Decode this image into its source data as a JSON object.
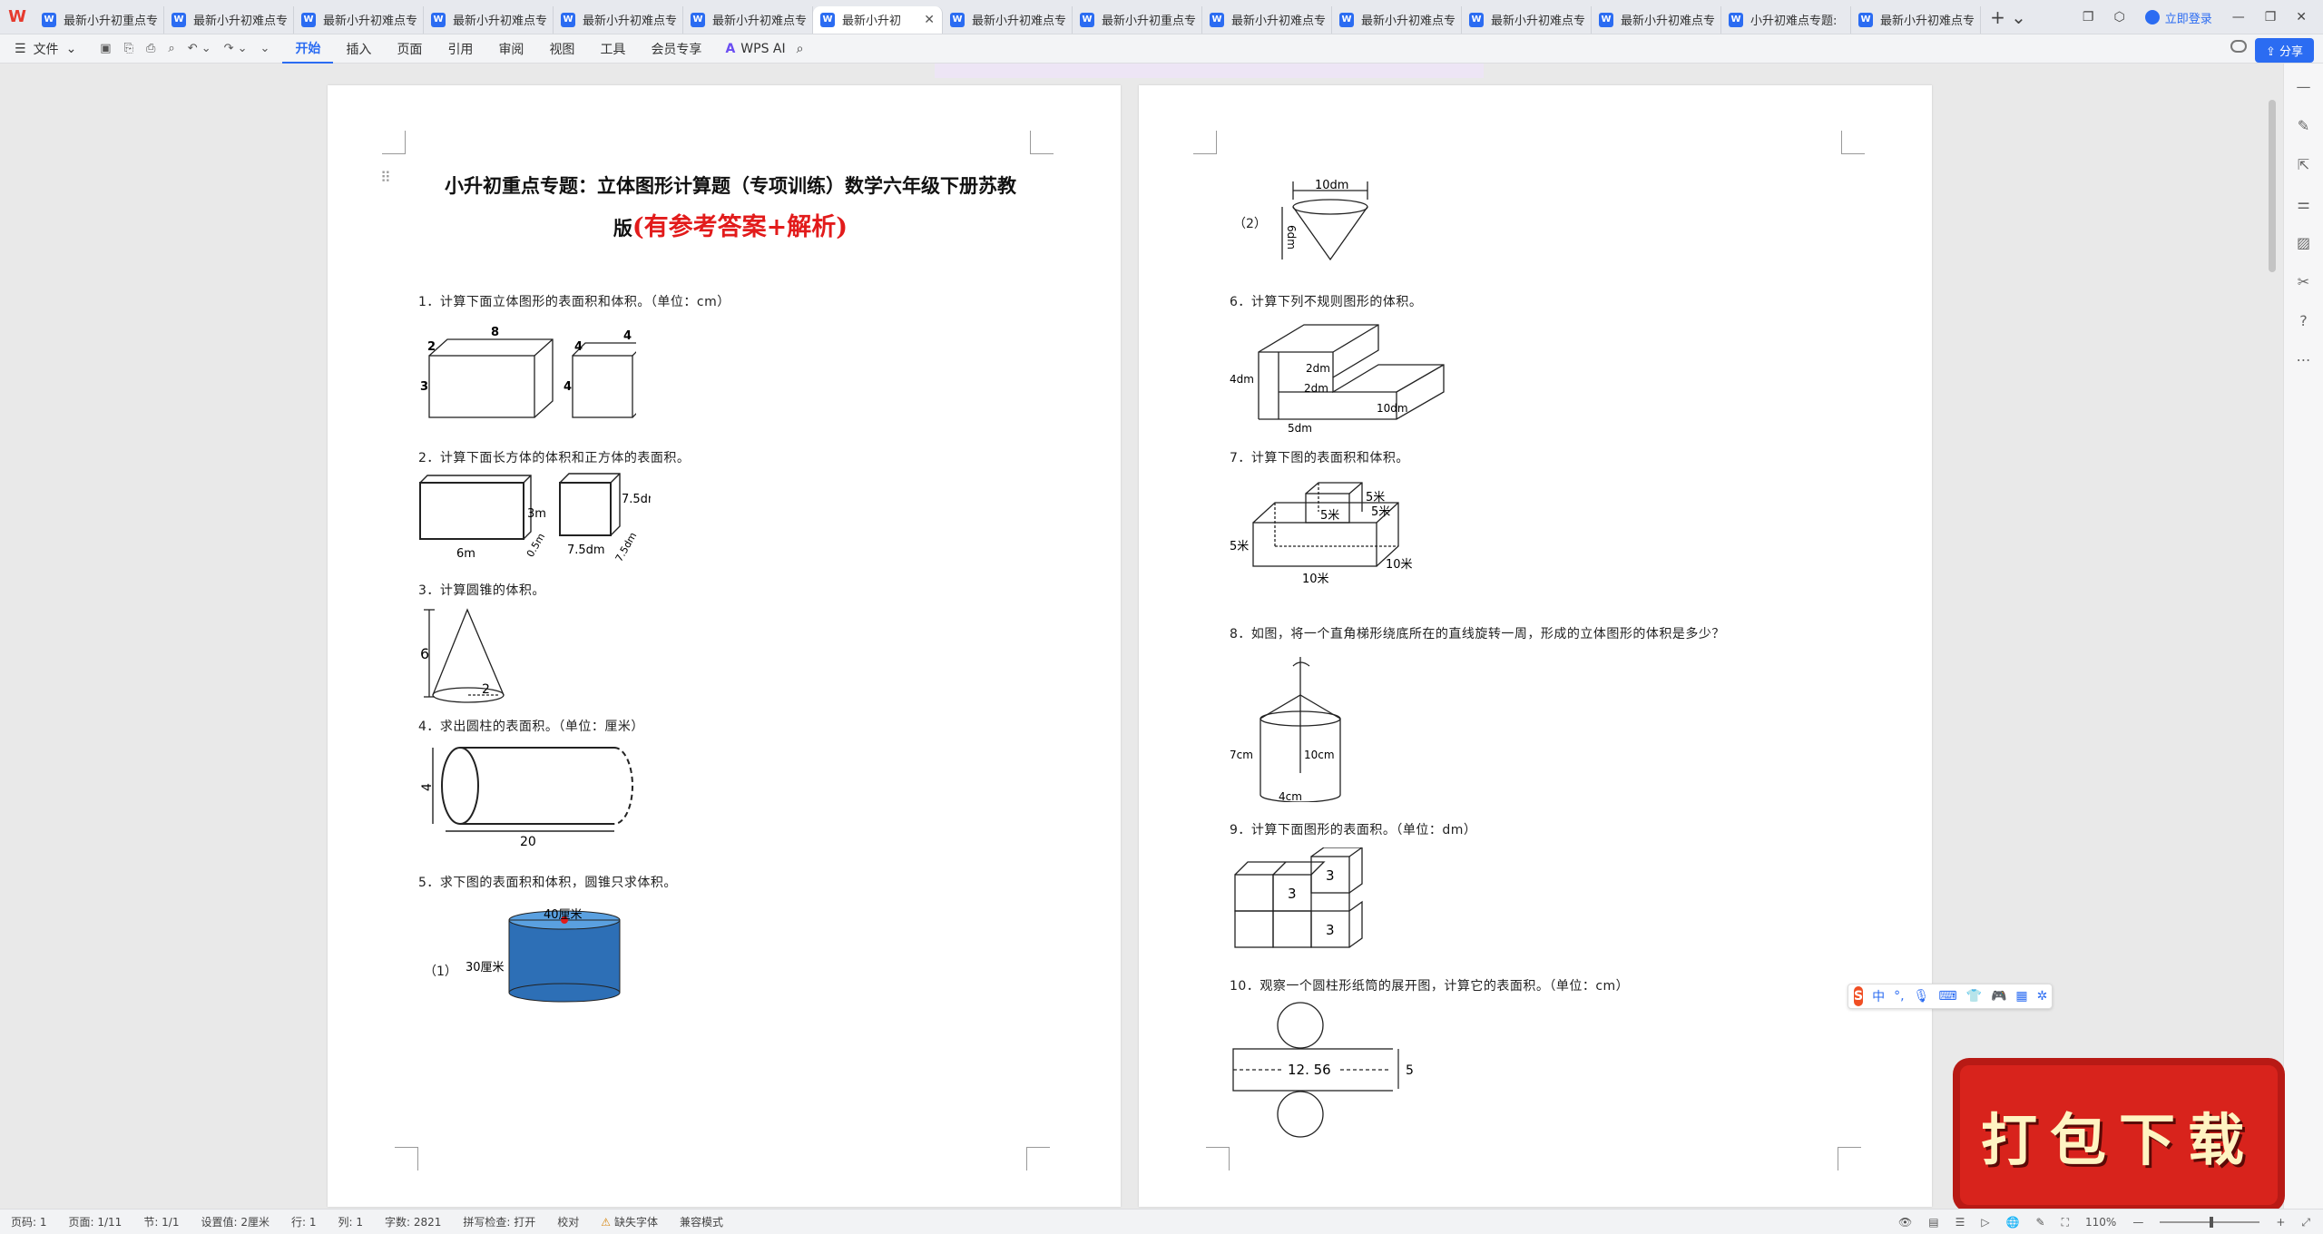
{
  "app": {
    "logo": "W"
  },
  "tabs": [
    {
      "label": "最新小升初重点专",
      "active": false
    },
    {
      "label": "最新小升初难点专",
      "active": false
    },
    {
      "label": "最新小升初难点专",
      "active": false
    },
    {
      "label": "最新小升初难点专",
      "active": false
    },
    {
      "label": "最新小升初难点专",
      "active": false
    },
    {
      "label": "最新小升初难点专",
      "active": false
    },
    {
      "label": "最新小升初",
      "active": true
    },
    {
      "label": "最新小升初难点专",
      "active": false
    },
    {
      "label": "最新小升初重点专",
      "active": false
    },
    {
      "label": "最新小升初难点专",
      "active": false
    },
    {
      "label": "最新小升初难点专",
      "active": false
    },
    {
      "label": "最新小升初难点专",
      "active": false
    },
    {
      "label": "最新小升初难点专",
      "active": false
    },
    {
      "label": "小升初难点专题:",
      "active": false
    },
    {
      "label": "最新小升初难点专",
      "active": false
    }
  ],
  "titlebar": {
    "login": "立即登录"
  },
  "menu": {
    "file": "文件",
    "items": [
      "开始",
      "插入",
      "页面",
      "引用",
      "审阅",
      "视图",
      "工具",
      "会员专享"
    ],
    "active_index": 0,
    "wps_ai": "WPS AI",
    "share": "分享"
  },
  "doc": {
    "title_line1": "小升初重点专题：立体图形计算题（专项训练）数学六年级下册苏教",
    "title_line2_prefix": "版",
    "title_line2_red": "(有参考答案+解析)",
    "left_questions": [
      "1．计算下面立体图形的表面积和体积。（单位：cm）",
      "2．计算下面长方体的体积和正方体的表面积。",
      "3．计算圆锥的体积。",
      "4．求出圆柱的表面积。（单位：厘米）",
      "5．求下图的表面积和体积，圆锥只求体积。"
    ],
    "right_questions": [
      "6．计算下列不规则图形的体积。",
      "7．计算下图的表面积和体积。",
      "8．如图，将一个直角梯形绕底所在的直线旋转一周，形成的立体图形的体积是多少？",
      "9．计算下面图形的表面积。（单位：dm）",
      "10．观察一个圆柱形纸筒的展开图，计算它的表面积。（单位：cm）"
    ],
    "sub5_1": "（1）",
    "sub5_2": "（2）",
    "fig_labels": {
      "q1a": [
        "8",
        "2",
        "3"
      ],
      "q1b": [
        "4",
        "4",
        "4"
      ],
      "q2a": [
        "3m",
        "0.5m",
        "6m"
      ],
      "q2b": [
        "7.5dm",
        "7.5dm",
        "7.5dm"
      ],
      "q3": [
        "6",
        "2"
      ],
      "q4": [
        "4",
        "20"
      ],
      "q5": [
        "40厘米",
        "30厘米"
      ],
      "q5b": [
        "10dm",
        "6dm"
      ],
      "q6": [
        "4dm",
        "2dm",
        "2dm",
        "5dm",
        "10dm"
      ],
      "q7": [
        "5米",
        "5米",
        "5米",
        "5米",
        "10米",
        "10米"
      ],
      "q8": [
        "7cm",
        "10cm",
        "4cm"
      ],
      "q9": [
        "3",
        "3",
        "3"
      ],
      "q10": [
        "12. 56",
        "5"
      ]
    }
  },
  "ime": {
    "logo": "S",
    "mode": "中"
  },
  "banner": {
    "text": "打包下载"
  },
  "status": {
    "page_code": "页码: 1",
    "page": "页面: 1/11",
    "section": "节: 1/1",
    "setting": "设置值: 2厘米",
    "row": "行: 1",
    "col": "列: 1",
    "words": "字数: 2821",
    "spell": "拼写检查: 打开",
    "proof": "校对",
    "missing_font": "缺失字体",
    "compat": "兼容模式",
    "zoom": "110%"
  }
}
